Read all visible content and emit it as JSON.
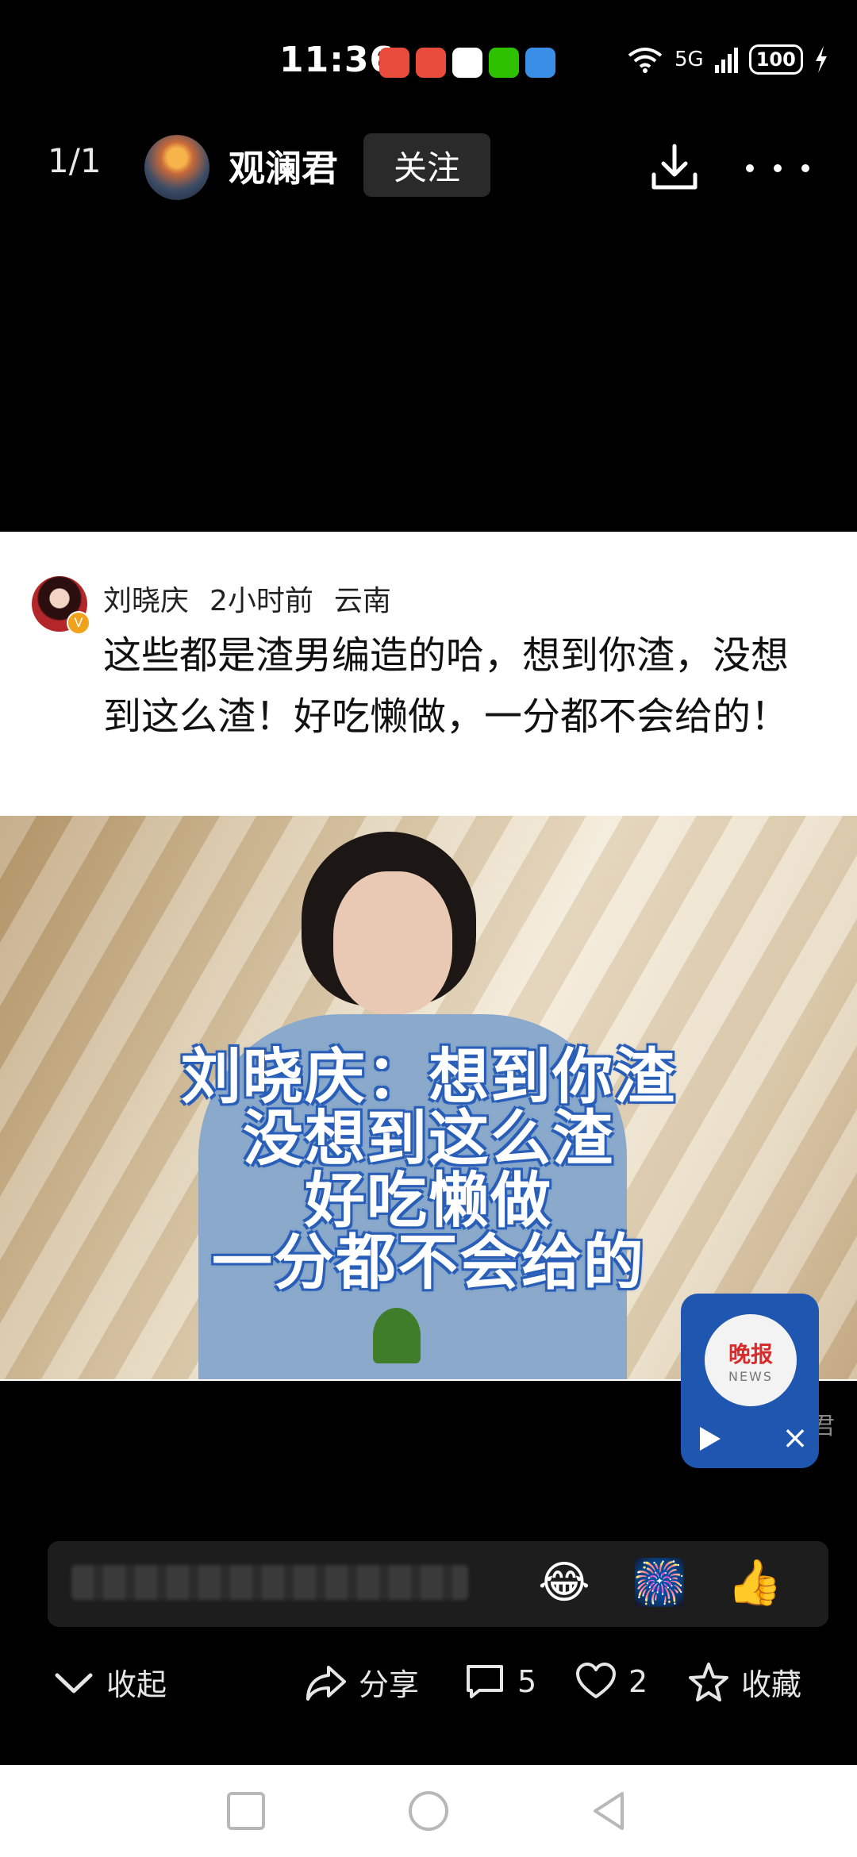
{
  "status_bar": {
    "time": "11:36",
    "network": "5G",
    "battery": "100",
    "app_icons": [
      "ticket-app-icon",
      "huawei-app-icon",
      "qq-icon",
      "wechat-icon",
      "browser-icon"
    ],
    "app_icon_colors": [
      "#e84b3c",
      "#e84b3c",
      "#ffffff",
      "#2dc100",
      "#3a8ee6"
    ]
  },
  "header": {
    "page_counter": "1/1",
    "username": "观澜君",
    "follow_label": "关注"
  },
  "post_image": {
    "comment_author": "刘晓庆",
    "comment_time": "2小时前",
    "comment_location": "云南",
    "comment_text": "这些都是渣男编造的哈，想到你渣，没想到这么渣！好吃懒做，一分都不会给的！",
    "video_caption_lines": [
      "刘晓庆：想到你渣",
      "没想到这么渣",
      "好吃懒做",
      "一分都不会给的"
    ]
  },
  "floating_player": {
    "logo_cn": "晚报",
    "logo_en": "NEWS",
    "close_symbol": "×"
  },
  "watermark": "君",
  "comment_bar": {
    "emojis": [
      "😂",
      "🎆",
      "👍"
    ]
  },
  "actions": {
    "collapse": "收起",
    "share": "分享",
    "comments": "5",
    "likes": "2",
    "favorite": "收藏"
  },
  "colors": {
    "accent_blue": "#1f57b0",
    "background": "#000000"
  }
}
